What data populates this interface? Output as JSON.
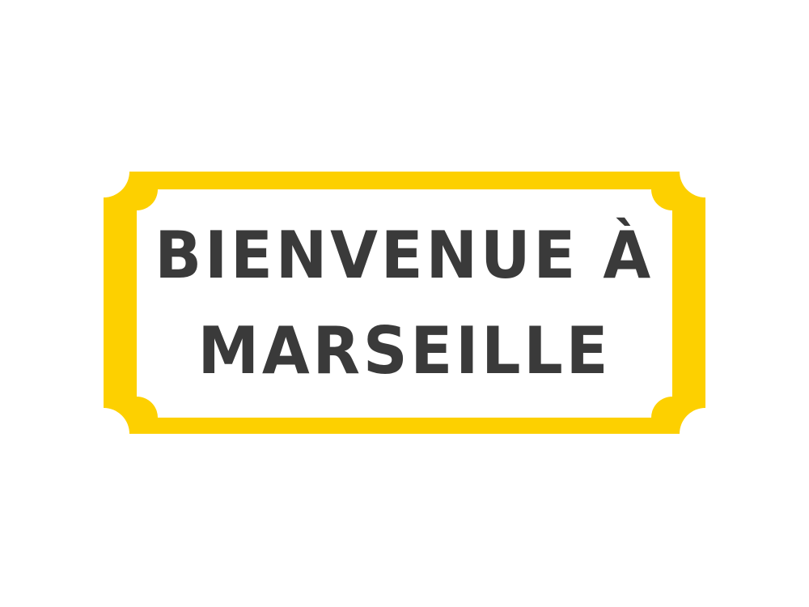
{
  "sign": {
    "line1": "BIENVENUE À",
    "line2": "MARSEILLE"
  },
  "colors": {
    "background": "#ffffff",
    "frame": "#FDD000",
    "panel": "#ffffff",
    "text": "#3a3a3a"
  }
}
